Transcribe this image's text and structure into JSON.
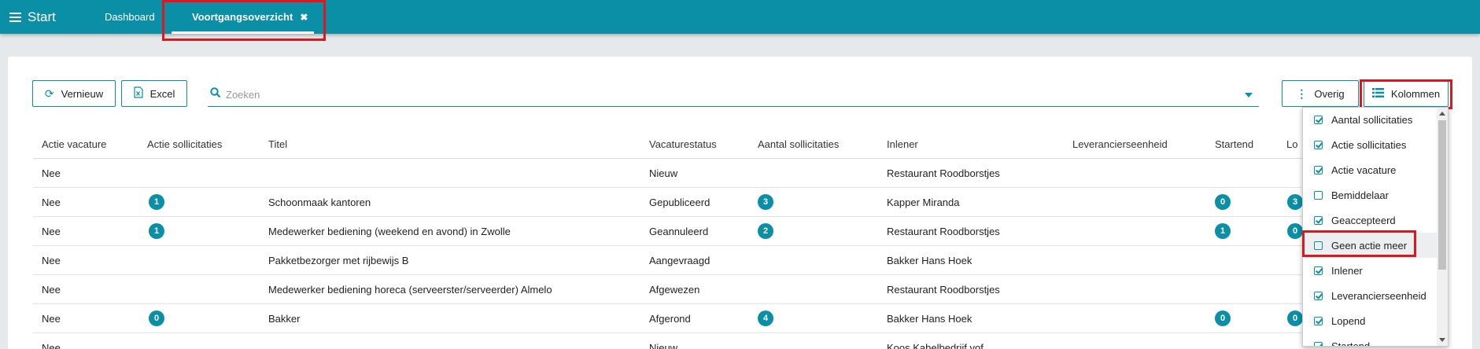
{
  "topbar": {
    "start_label": "Start",
    "tabs": [
      {
        "label": "Dashboard"
      },
      {
        "label": "Voortgangsoverzicht",
        "close": "✖"
      }
    ]
  },
  "toolbar": {
    "refresh_label": "Vernieuw",
    "excel_label": "Excel",
    "search_placeholder": "Zoeken",
    "overig_label": "Overig",
    "kolommen_label": "Kolommen"
  },
  "table": {
    "headers": [
      "Actie vacature",
      "Actie sollicitaties",
      "Titel",
      "Vacaturestatus",
      "Aantal sollicitaties",
      "Inlener",
      "Leverancierseenheid",
      "Startend",
      "Lo"
    ],
    "rows": [
      {
        "actie_vacature": "Nee",
        "actie_sollicitaties": "",
        "titel": "",
        "status": "Nieuw",
        "aantal": "",
        "inlener": "Restaurant Roodborstjes",
        "startend": "",
        "lopend": ""
      },
      {
        "actie_vacature": "Nee",
        "actie_sollicitaties": "1",
        "titel": "Schoonmaak kantoren",
        "status": "Gepubliceerd",
        "aantal": "3",
        "inlener": "Kapper Miranda",
        "startend": "0",
        "lopend": "3"
      },
      {
        "actie_vacature": "Nee",
        "actie_sollicitaties": "1",
        "titel": "Medewerker bediening (weekend en avond) in Zwolle",
        "status": "Geannuleerd",
        "aantal": "2",
        "inlener": "Restaurant Roodborstjes",
        "startend": "1",
        "lopend": "0"
      },
      {
        "actie_vacature": "Nee",
        "actie_sollicitaties": "",
        "titel": "Pakketbezorger met rijbewijs B",
        "status": "Aangevraagd",
        "aantal": "",
        "inlener": "Bakker Hans Hoek",
        "startend": "",
        "lopend": ""
      },
      {
        "actie_vacature": "Nee",
        "actie_sollicitaties": "",
        "titel": "Medewerker bediening horeca (serveerster/serveerder) Almelo",
        "status": "Afgewezen",
        "aantal": "",
        "inlener": "Restaurant Roodborstjes",
        "startend": "",
        "lopend": ""
      },
      {
        "actie_vacature": "Nee",
        "actie_sollicitaties": "0",
        "titel": "Bakker",
        "status": "Afgerond",
        "aantal": "4",
        "inlener": "Bakker Hans Hoek",
        "startend": "0",
        "lopend": "0"
      },
      {
        "actie_vacature": "Nee",
        "actie_sollicitaties": "",
        "titel": "",
        "status": "Nieuw",
        "aantal": "",
        "inlener": "Koos Kabelbedrijf vof",
        "startend": "",
        "lopend": ""
      }
    ]
  },
  "columns_menu": {
    "items": [
      {
        "label": "Aantal sollicitaties",
        "checked": true
      },
      {
        "label": "Actie sollicitaties",
        "checked": true
      },
      {
        "label": "Actie vacature",
        "checked": true
      },
      {
        "label": "Bemiddelaar",
        "checked": false
      },
      {
        "label": "Geaccepteerd",
        "checked": true
      },
      {
        "label": "Geen actie meer",
        "checked": false
      },
      {
        "label": "Inlener",
        "checked": true
      },
      {
        "label": "Leverancierseenheid",
        "checked": true
      },
      {
        "label": "Lopend",
        "checked": true
      },
      {
        "label": "Startend",
        "checked": true
      }
    ]
  },
  "colors": {
    "accent": "#0a8fa6",
    "highlight": "#e0161f"
  }
}
